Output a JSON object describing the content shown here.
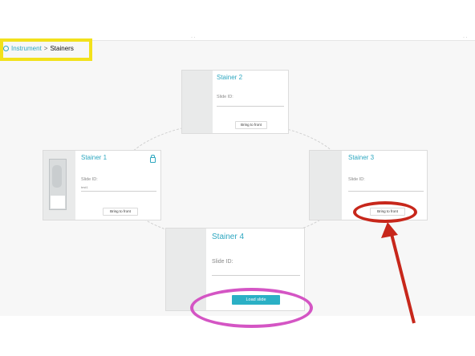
{
  "breadcrumb": {
    "parent": "Instrument",
    "separator": ">",
    "current": "Stainers"
  },
  "stainers": [
    {
      "title": "Stainer 2",
      "slide_id_label": "Slide ID:",
      "slide_id_value": "",
      "button": "Bring to front"
    },
    {
      "title": "Stainer 1",
      "slide_id_label": "Slide ID:",
      "slide_id_value": "test1",
      "button": "Bring to front",
      "locked": true
    },
    {
      "title": "Stainer 3",
      "slide_id_label": "Slide ID:",
      "slide_id_value": "",
      "button": "Bring to front"
    },
    {
      "title": "Stainer 4",
      "slide_id_label": "Slide ID:",
      "slide_id_value": "",
      "button": "Load slide"
    }
  ],
  "annotations": {
    "highlight_color": "#f2e11b",
    "circle_color_red": "#c7271b",
    "circle_color_pink": "#d455c4",
    "arrow_color": "#c7271b"
  },
  "colors": {
    "accent": "#2ea7c0",
    "load_button": "#2bb0c5"
  }
}
